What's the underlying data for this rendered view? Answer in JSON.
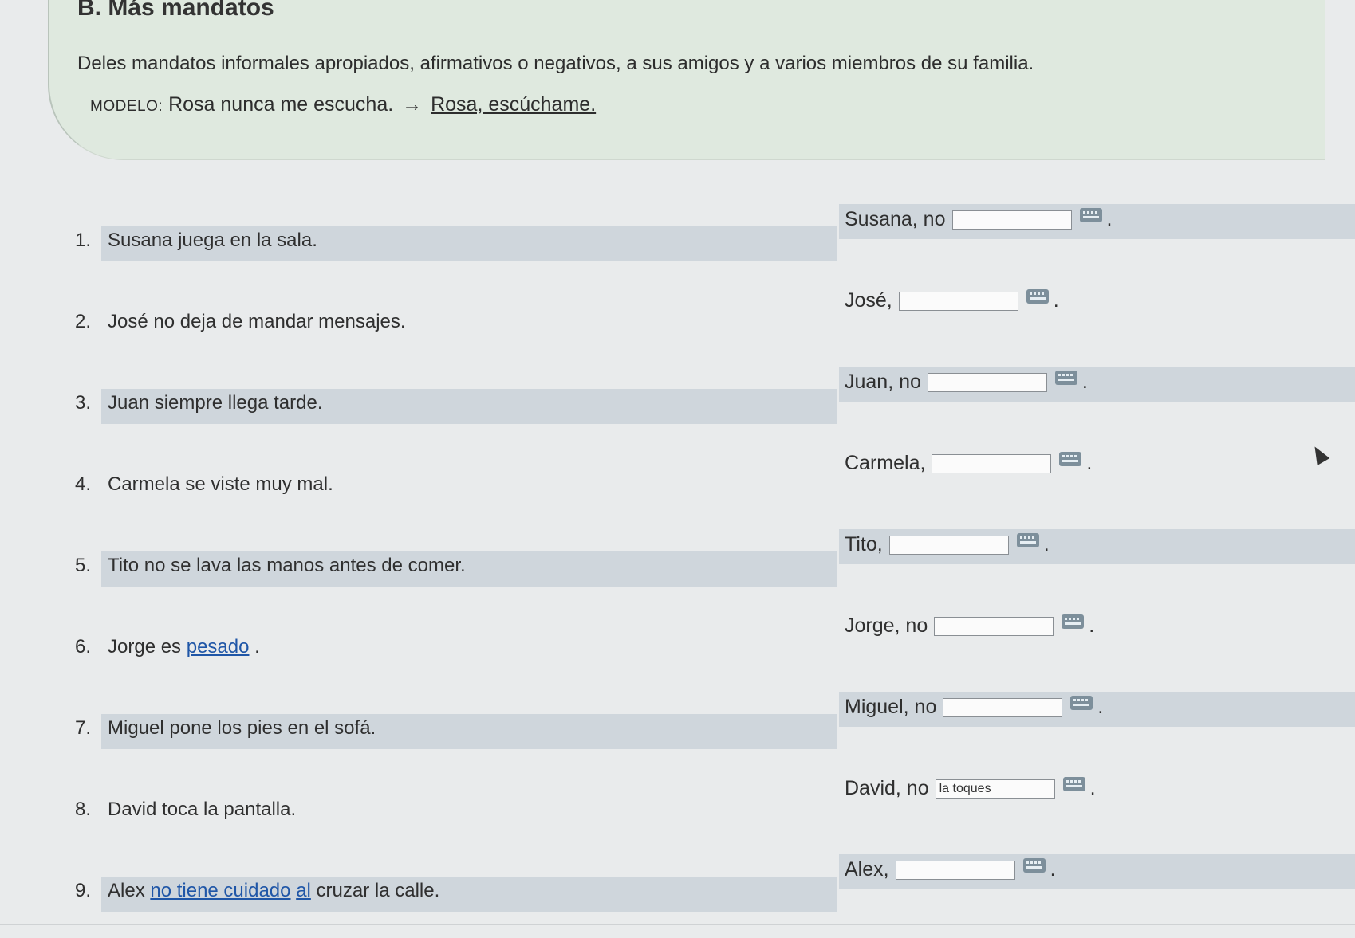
{
  "section": {
    "heading": "B. Más mandatos",
    "instructions": "Deles mandatos informales apropiados, afirmativos o negativos, a sus amigos y a varios miembros de su familia.",
    "modelo_label": "MODELO:",
    "modelo_sentence": "Rosa nunca me escucha.",
    "modelo_arrow": "→",
    "modelo_answer": "Rosa, escúchame."
  },
  "items": [
    {
      "num": "1.",
      "s1": "Susana juega en la sala.",
      "link": "",
      "s2": "",
      "link2": "",
      "s3": "",
      "prompt": "Susana, no",
      "value": "",
      "period": "."
    },
    {
      "num": "2.",
      "s1": "José no deja de mandar mensajes.",
      "link": "",
      "s2": "",
      "link2": "",
      "s3": "",
      "prompt": "José,",
      "value": "",
      "period": "."
    },
    {
      "num": "3.",
      "s1": "Juan siempre llega tarde.",
      "link": "",
      "s2": "",
      "link2": "",
      "s3": "",
      "prompt": "Juan, no",
      "value": "",
      "period": "."
    },
    {
      "num": "4.",
      "s1": "Carmela se viste muy mal.",
      "link": "",
      "s2": "",
      "link2": "",
      "s3": "",
      "prompt": "Carmela,",
      "value": "",
      "period": "."
    },
    {
      "num": "5.",
      "s1": "Tito no se lava las manos antes de comer.",
      "link": "",
      "s2": "",
      "link2": "",
      "s3": "",
      "prompt": "Tito,",
      "value": "",
      "period": "."
    },
    {
      "num": "6.",
      "s1": "Jorge es ",
      "link": "pesado",
      "s2": " .",
      "link2": "",
      "s3": "",
      "prompt": "Jorge, no",
      "value": "",
      "period": "."
    },
    {
      "num": "7.",
      "s1": "Miguel pone los pies en el sofá.",
      "link": "",
      "s2": "",
      "link2": "",
      "s3": "",
      "prompt": "Miguel, no",
      "value": "",
      "period": "."
    },
    {
      "num": "8.",
      "s1": "David toca la pantalla.",
      "link": "",
      "s2": "",
      "link2": "",
      "s3": "",
      "prompt": "David, no",
      "value": "la toques",
      "period": "."
    },
    {
      "num": "9.",
      "s1": "Alex ",
      "link": "no tiene cuidado",
      "s2": " ",
      "link2": "al",
      "s3": " cruzar la calle.",
      "prompt": "Alex,",
      "value": "",
      "period": "."
    }
  ]
}
